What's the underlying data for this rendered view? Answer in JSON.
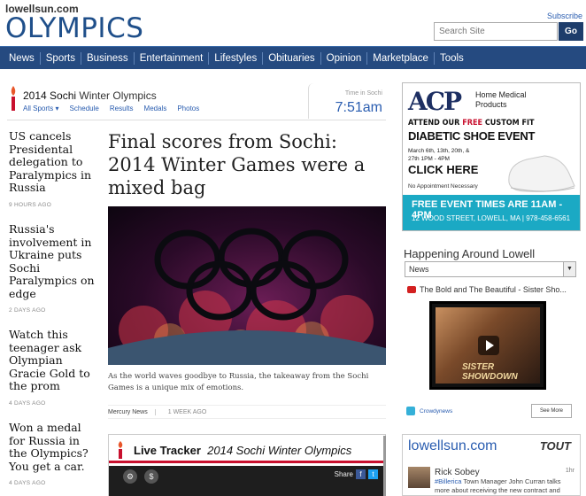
{
  "header": {
    "site_logo": "lowellsun.com",
    "section_title": "OLYMPICS",
    "subscribe": "Subscribe",
    "search_placeholder": "Search Site",
    "go": "Go"
  },
  "nav": [
    "News",
    "Sports",
    "Business",
    "Entertainment",
    "Lifestyles",
    "Obituaries",
    "Opinion",
    "Marketplace",
    "Tools"
  ],
  "sochi_bar": {
    "title_bold": "2014 Sochi",
    "title_rest": " Winter Olympics",
    "links": [
      "All Sports ▾",
      "Schedule",
      "Results",
      "Medals",
      "Photos"
    ],
    "time_label": "Time in Sochi",
    "time_value": "7:51am"
  },
  "side_stories": [
    {
      "headline": "US cancels Presidental delegation to Paralympics in Russia",
      "age": "9 HOURS AGO"
    },
    {
      "headline": "Russia's involvement in Ukraine puts Sochi Paralympics on edge",
      "age": "2 DAYS AGO"
    },
    {
      "headline": "Watch this teenager ask Olympian Gracie Gold to the prom",
      "age": "4 DAYS AGO"
    },
    {
      "headline": "Won a medal for Russia in the Olympics? You get a car.",
      "age": "4 DAYS AGO"
    }
  ],
  "article": {
    "headline": "Final scores from Sochi: 2014 Winter Games were a mixed bag",
    "caption": "As the world waves goodbye to Russia, the takeaway from the Sochi Games is a unique mix of emotions.",
    "source": "Mercury News",
    "age": "1 WEEK AGO"
  },
  "tracker": {
    "label": "Live Tracker",
    "title": "2014 Sochi Winter Olympics",
    "share": "Share"
  },
  "ad": {
    "logo": "ACP",
    "logo_sub": "Home Medical Products",
    "line1_a": "ATTEND OUR ",
    "line1_b": "FREE",
    "line1_c": " CUSTOM FIT",
    "line2": "DIABETIC SHOE EVENT",
    "dates": "March 6th, 13th, 20th, & 27th 1PM - 4PM",
    "click": "CLICK HERE",
    "appt": "No Appointment Necessary",
    "foot1": "FREE EVENT  TIMES ARE 11AM - 4PM",
    "foot2": "12 WOOD STREET, LOWELL, MA  |  978-458-6561"
  },
  "happening": {
    "title": "Happening Around Lowell",
    "select_value": "News",
    "video_title": "The Bold and The Beautiful - Sister Sho...",
    "video_overlay": "SISTER SHOWDOWN",
    "crowd": "Crowdynews",
    "see_more": "See More"
  },
  "widget": {
    "logo": "lowellsun.com",
    "brand": "TOUT",
    "user": "Rick Sobey",
    "time": "1hr",
    "tag": "#Billerica",
    "text": " Town Manager John Curran talks more about receiving the new contract and"
  }
}
